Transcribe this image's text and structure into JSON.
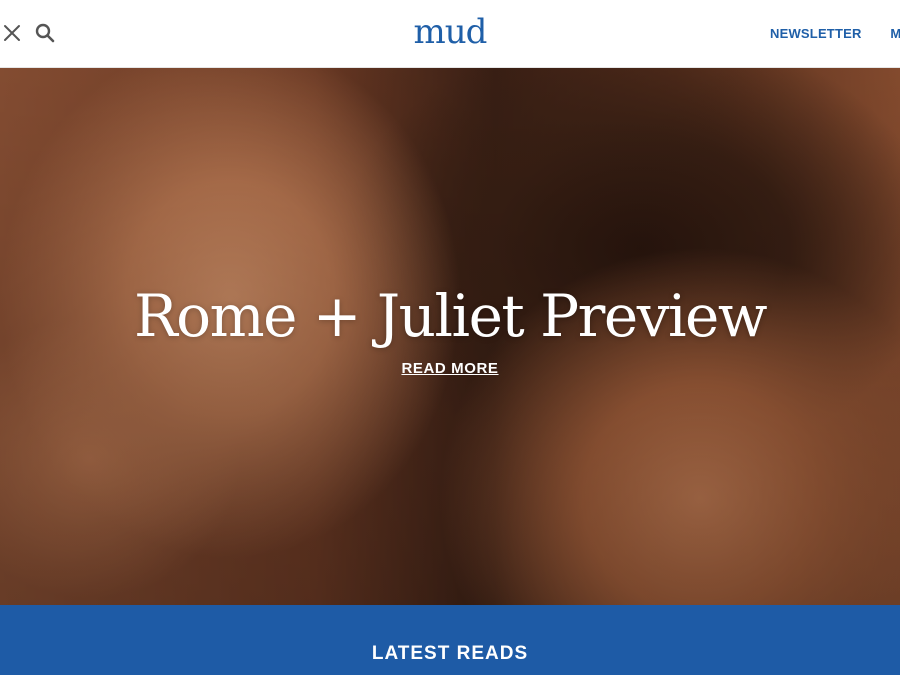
{
  "header": {
    "logo": "mud",
    "icons": [
      "x-twitter-icon",
      "search-icon"
    ],
    "nav": [
      {
        "label": "NEWSLETTER"
      },
      {
        "label": "MAG"
      }
    ]
  },
  "hero": {
    "title": "Rome + Juliet Preview",
    "link_label": "READ MORE"
  },
  "latest": {
    "title": "LATEST READS"
  },
  "colors": {
    "brand_blue": "#1e5ba6",
    "white": "#ffffff"
  }
}
